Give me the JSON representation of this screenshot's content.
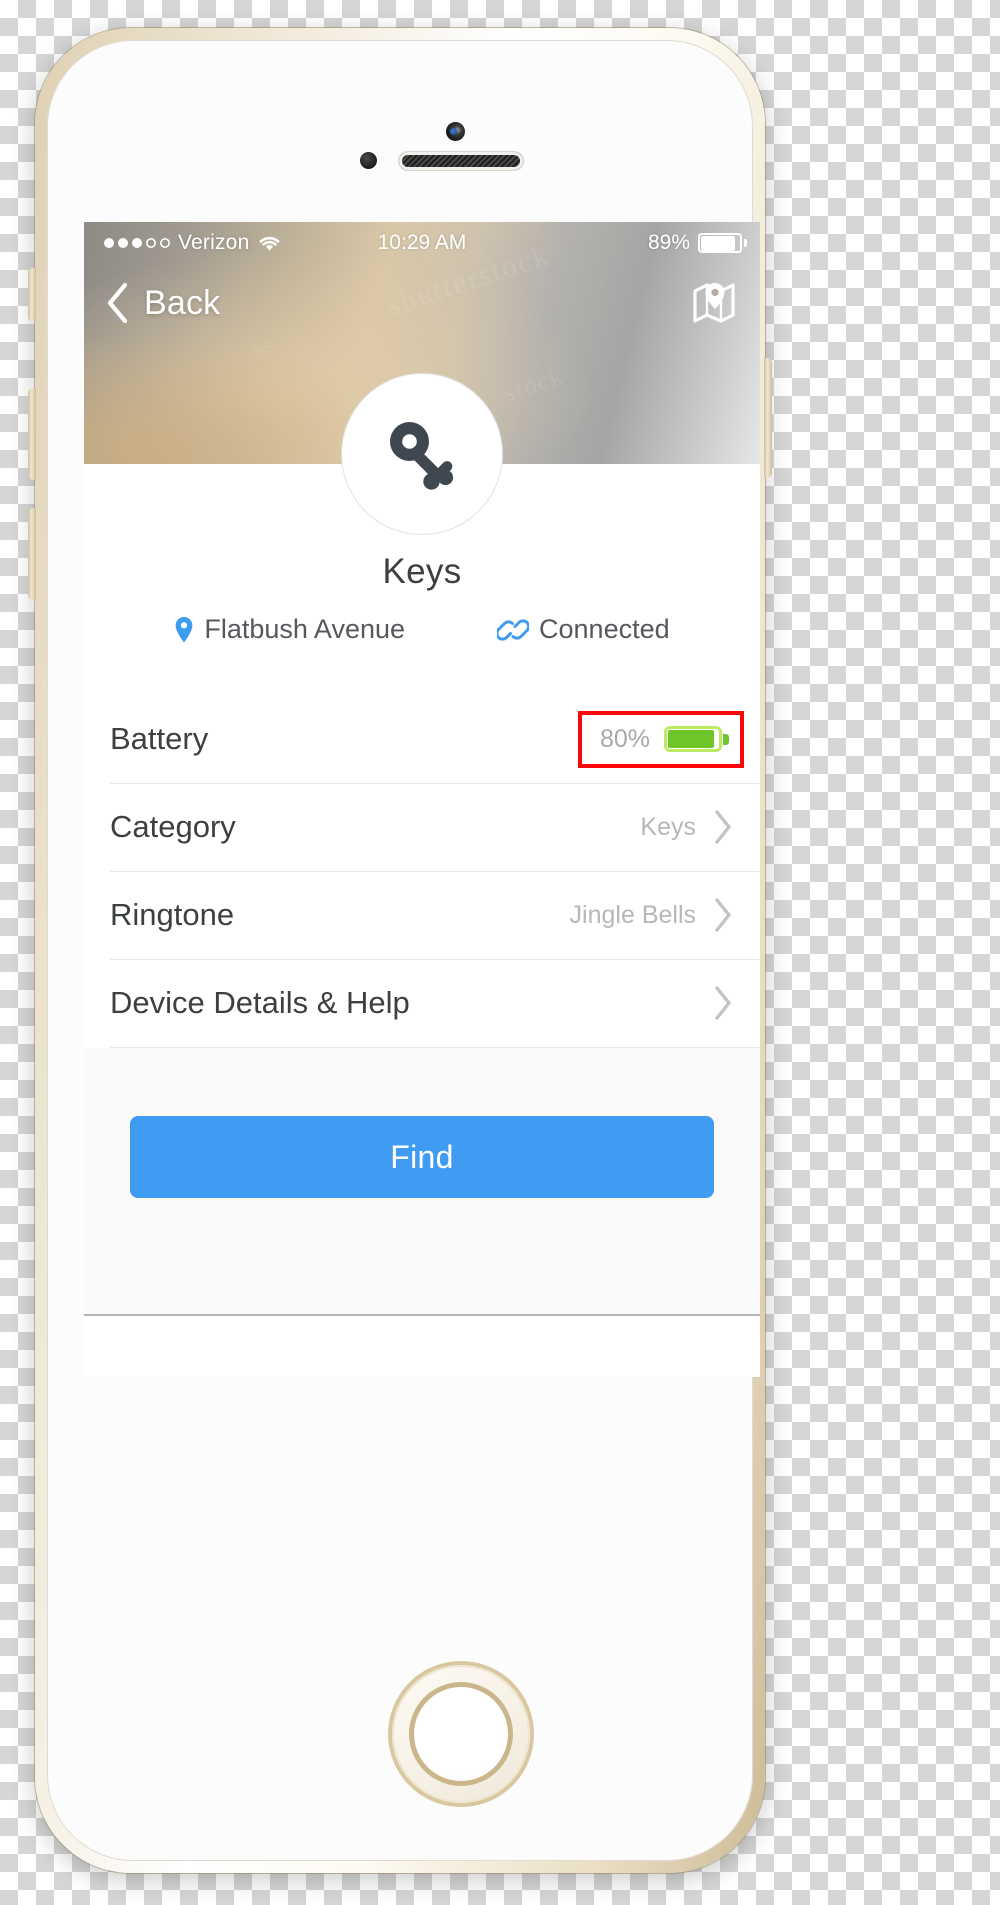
{
  "status_bar": {
    "signal_dots_filled": 3,
    "signal_dots_total": 5,
    "carrier": "Verizon",
    "wifi_icon": "wifi-icon",
    "time": "10:29 AM",
    "battery_percent": "89%",
    "battery_level": 89
  },
  "nav": {
    "back_label": "Back",
    "back_icon": "chevron-left-icon",
    "map_icon": "map-pin-icon"
  },
  "device": {
    "avatar_icon": "key-icon",
    "name": "Keys",
    "location_icon": "location-pin-icon",
    "location": "Flatbush Avenue",
    "connection_icon": "link-icon",
    "connection_status": "Connected"
  },
  "rows": [
    {
      "label": "Battery",
      "value": "80%",
      "value_type": "battery",
      "battery_level": 80,
      "highlighted": true,
      "chevron": false
    },
    {
      "label": "Category",
      "value": "Keys",
      "value_type": "text",
      "highlighted": false,
      "chevron": true
    },
    {
      "label": "Ringtone",
      "value": "Jingle Bells",
      "value_type": "text",
      "highlighted": false,
      "chevron": true
    },
    {
      "label": "Device Details & Help",
      "value": "",
      "value_type": "text",
      "highlighted": false,
      "chevron": true
    }
  ],
  "footer": {
    "find_label": "Find"
  },
  "colors": {
    "accent_blue": "#409cf2",
    "highlight_red": "#fb0707",
    "battery_green": "#6ec527",
    "icon_dark": "#3f4750",
    "muted_text": "#b7b7b7"
  },
  "watermark": {
    "line1": "shutterstock",
    "line2": "stock",
    "line3": "ss"
  }
}
